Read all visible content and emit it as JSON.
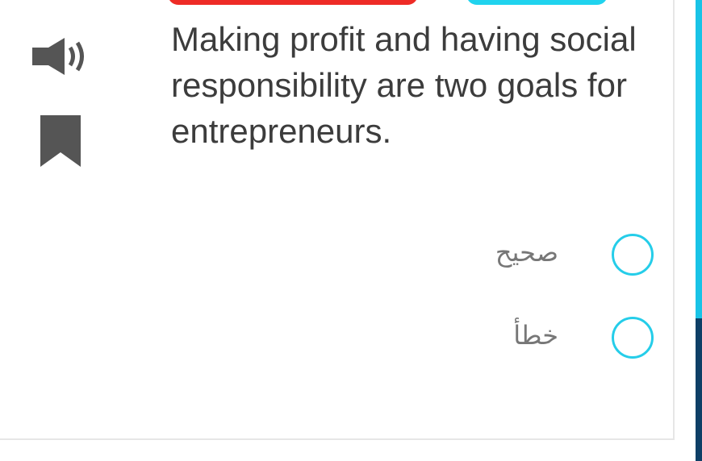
{
  "question": {
    "text": "Making profit and having social responsibility are two goals for entrepreneurs."
  },
  "icons": {
    "speaker": "speaker-icon",
    "bookmark": "bookmark-icon"
  },
  "options": [
    {
      "label": "صحيح",
      "selected": false
    },
    {
      "label": "خطأ",
      "selected": false
    }
  ],
  "colors": {
    "top_button_red": "#ee2b26",
    "top_button_cyan": "#20d3ee",
    "radio_border": "#25cde9",
    "text": "#3c3c3c",
    "icon": "#555555",
    "edge_strip_cyan": "#19c3e6",
    "edge_strip_dark": "#0e3f66"
  }
}
